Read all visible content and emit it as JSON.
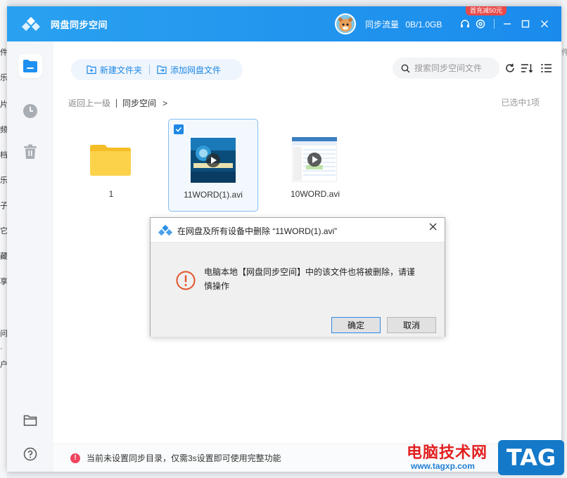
{
  "background_fragments": {
    "left": [
      "件",
      "乐",
      "片",
      "频",
      "档",
      "乐",
      "子",
      "它",
      "藏",
      "享",
      "问",
      "·",
      "户"
    ],
    "right": "件"
  },
  "titlebar": {
    "app_title": "网盘同步空间",
    "traffic_label": "同步流量",
    "traffic_value": "0B/1.0GB",
    "promo_badge": "首充减50元",
    "accent": "#1a8bec"
  },
  "sidebar": {
    "items": [
      {
        "name": "sync-space",
        "icon": "folder-file-icon",
        "active": true
      },
      {
        "name": "history",
        "icon": "clock-icon",
        "active": false
      },
      {
        "name": "trash",
        "icon": "trash-icon",
        "active": false
      },
      {
        "name": "open-folder",
        "icon": "folder-icon",
        "active": false
      },
      {
        "name": "help",
        "icon": "help-icon",
        "active": false
      }
    ]
  },
  "toolbar": {
    "new_folder_label": "新建文件夹",
    "add_files_label": "添加网盘文件",
    "search_placeholder": "搜索同步空间文件"
  },
  "breadcrumb": {
    "back_label": "返回上一级",
    "current": "同步空间",
    "arrow": ">"
  },
  "selection_status": "已选中1项",
  "files": [
    {
      "name": "1",
      "type": "folder",
      "selected": false
    },
    {
      "name": "11WORD(1).avi",
      "type": "video",
      "selected": true
    },
    {
      "name": "10WORD.avi",
      "type": "video",
      "selected": false
    }
  ],
  "bottom_notice": "当前未设置同步目录，仅需3s设置即可使用完整功能",
  "dialog": {
    "title": "在网盘及所有设备中删除 “11WORD(1).avi”",
    "message": "电脑本地【网盘同步空间】中的该文件也将被删除，请谨慎操作",
    "confirm_label": "确定",
    "cancel_label": "取消",
    "alert_color": "#e0542a"
  },
  "watermark": {
    "site_name": "电脑技术网",
    "url": "www.tagxp.com",
    "tag": "TAG"
  }
}
